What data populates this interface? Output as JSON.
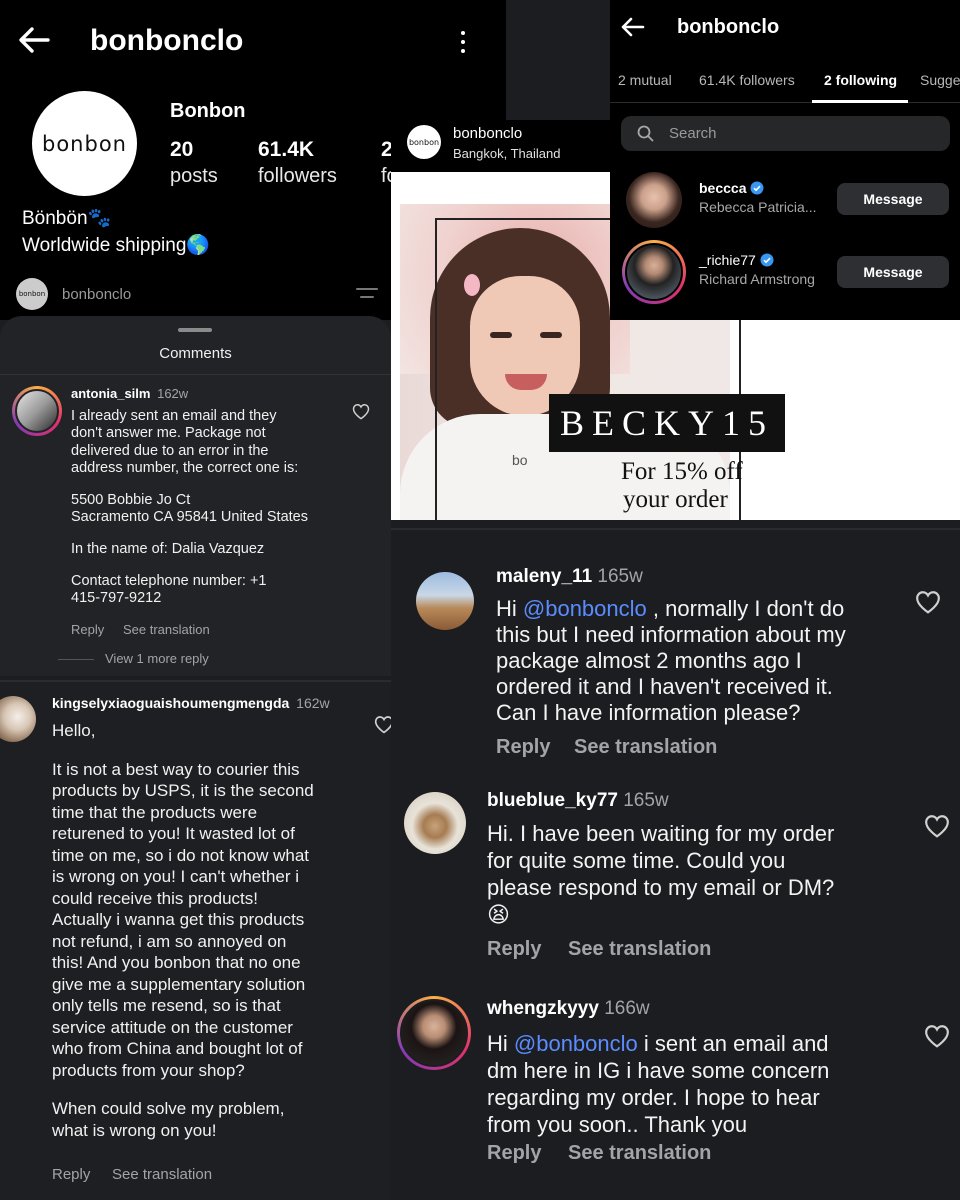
{
  "profile": {
    "username": "bonbonclo",
    "display_name": "Bonbon",
    "logo_text": "bonbon",
    "posts": {
      "count": "20",
      "label": "posts"
    },
    "followers": {
      "count": "61.4K",
      "label": "followers"
    },
    "following": {
      "count": "2",
      "label": "fo"
    },
    "bio_line1": "Bönbön🐾",
    "bio_line2": "Worldwide shipping🌎"
  },
  "post_header": {
    "username": "bonbonclo",
    "location": "Bangkok, Thailand",
    "logo_text": "bonbon"
  },
  "post_image": {
    "promo_code": "BECKY15",
    "promo_line1": "For 15% off",
    "promo_line2": "your order",
    "hoodie_text": "bo"
  },
  "following_panel": {
    "title": "bonbonclo",
    "tabs": [
      "2 mutual",
      "61.4K followers",
      "2 following",
      "Sugge"
    ],
    "search_placeholder": "Search",
    "users": [
      {
        "username": "beccca",
        "name": "Rebecca Patricia...",
        "button": "Message"
      },
      {
        "username": "_richie77",
        "name": "Richard Armstrong",
        "button": "Message"
      }
    ]
  },
  "mini_header": {
    "username": "bonbonclo",
    "logo_text": "bonbon"
  },
  "comments_sheet": {
    "title": "Comments",
    "comment": {
      "username": "antonia_silm",
      "time": "162w",
      "lines": [
        "I already sent an email and they",
        "don't answer me. Package not",
        "delivered due to an error in the",
        "address number, the correct one is:",
        "",
        "5500 Bobbie Jo Ct",
        "Sacramento CA 95841 United States",
        "",
        "In the name of: Dalia Vazquez",
        "",
        "Contact telephone number: +1",
        "415-797-9212"
      ],
      "reply": "Reply",
      "translate": "See translation",
      "more_replies": "View 1 more reply"
    }
  },
  "kingsely_comment": {
    "username": "kingselyxiaoguaishoumengmengda",
    "time": "162w",
    "lines": [
      "Hello,",
      "",
      "It is not a best way to courier this",
      "products by USPS, it is the second",
      "time that the products were",
      "returened to you! It wasted lot of",
      "time on me, so i do not know what",
      "is wrong on you!  I can't whether i",
      "could receive this products!",
      "Actually i wanna get this products",
      "not refund, i am so annoyed on",
      "this! And you bonbon that no one",
      "give me a supplementary solution",
      "only tells me resend, so is that",
      "service attitude on the customer",
      "who from China and bought lot of",
      "products from your shop?",
      "",
      "When could solve my problem,",
      "what is wrong on you!"
    ],
    "reply": "Reply",
    "translate": "See translation"
  },
  "right_comments": [
    {
      "username": "maleny_11",
      "time": "165w",
      "lines": [
        "Hi @bonbonclo , normally I don't do",
        "this but I need information about my",
        "package almost 2 months ago I",
        "ordered it and I haven't received it.",
        "Can I have information please?"
      ],
      "reply": "Reply",
      "translate": "See translation"
    },
    {
      "username": "blueblue_ky77",
      "time": "165w",
      "lines": [
        "Hi. I have been waiting for my order",
        "for quite some time. Could you",
        "please respond to my email or DM?",
        "😫"
      ],
      "reply": "Reply",
      "translate": "See translation"
    },
    {
      "username": "whengzkyyy",
      "time": "166w",
      "lines": [
        "Hi @bonbonclo i sent an email and",
        "dm here in IG i have some concern",
        "regarding my order. I hope to hear",
        "from you soon.. Thank you"
      ],
      "reply": "Reply",
      "translate": "See translation"
    }
  ],
  "colors": {
    "accent_blue": "#5b8cff",
    "verified_blue": "#3897f0",
    "dark_bg": "#1c1d20",
    "black": "#000000"
  }
}
